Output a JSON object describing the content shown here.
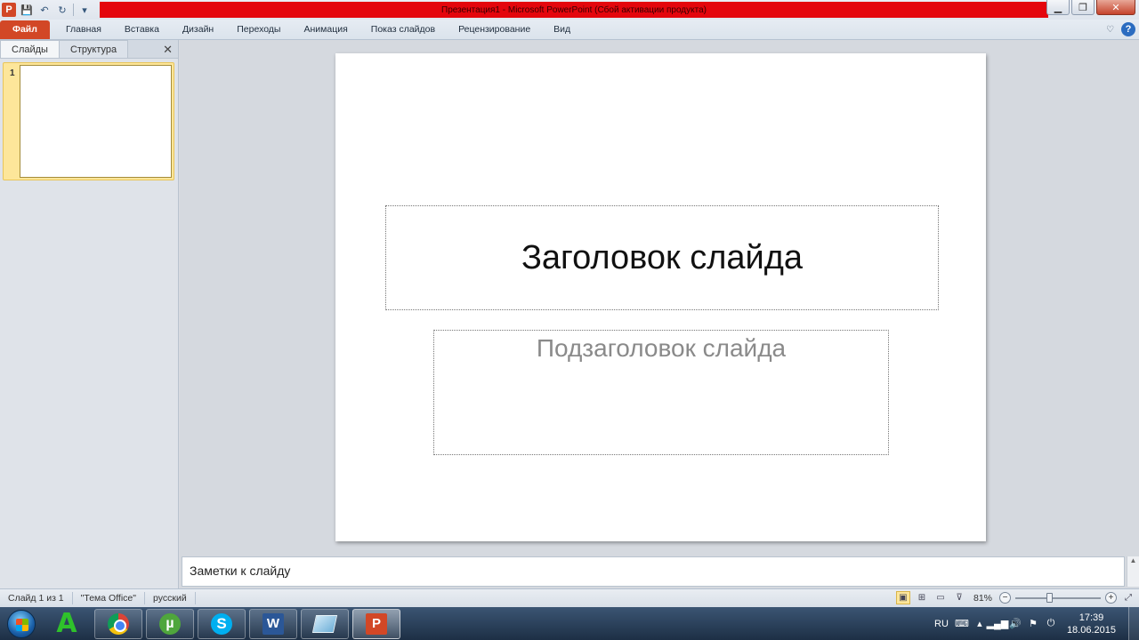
{
  "window": {
    "title": "Презентация1  -  Microsoft PowerPoint (Сбой активации продукта)",
    "app_icon_letter": "P"
  },
  "quick_access": [
    {
      "name": "save-icon",
      "glyph": "💾"
    },
    {
      "name": "undo-icon",
      "glyph": "↶"
    },
    {
      "name": "redo-icon",
      "glyph": "↻"
    },
    {
      "name": "customize-icon",
      "glyph": "▾"
    }
  ],
  "ribbon": {
    "file_tab": "Файл",
    "tabs": [
      "Главная",
      "Вставка",
      "Дизайн",
      "Переходы",
      "Анимация",
      "Показ слайдов",
      "Рецензирование",
      "Вид"
    ]
  },
  "left_pane": {
    "tab_slides": "Слайды",
    "tab_outline": "Структура",
    "close": "✕",
    "slide_number": "1"
  },
  "slide": {
    "title_placeholder": "Заголовок слайда",
    "subtitle_placeholder": "Подзаголовок слайда"
  },
  "notes": {
    "placeholder": "Заметки к слайду"
  },
  "status": {
    "slide_info": "Слайд 1 из 1",
    "theme": "\"Тема Office\"",
    "language": "русский",
    "zoom_percent": "81%",
    "zoom_value": 81
  },
  "taskbar": {
    "apps": [
      {
        "name": "a-app",
        "letter": "A"
      },
      {
        "name": "chrome"
      },
      {
        "name": "utorrent",
        "letter": "µ"
      },
      {
        "name": "skype",
        "letter": "S"
      },
      {
        "name": "word",
        "letter": "W"
      },
      {
        "name": "sheet"
      },
      {
        "name": "powerpoint",
        "letter": "P"
      }
    ],
    "tray": {
      "language": "RU",
      "time": "17:39",
      "date": "18.06.2015"
    }
  }
}
